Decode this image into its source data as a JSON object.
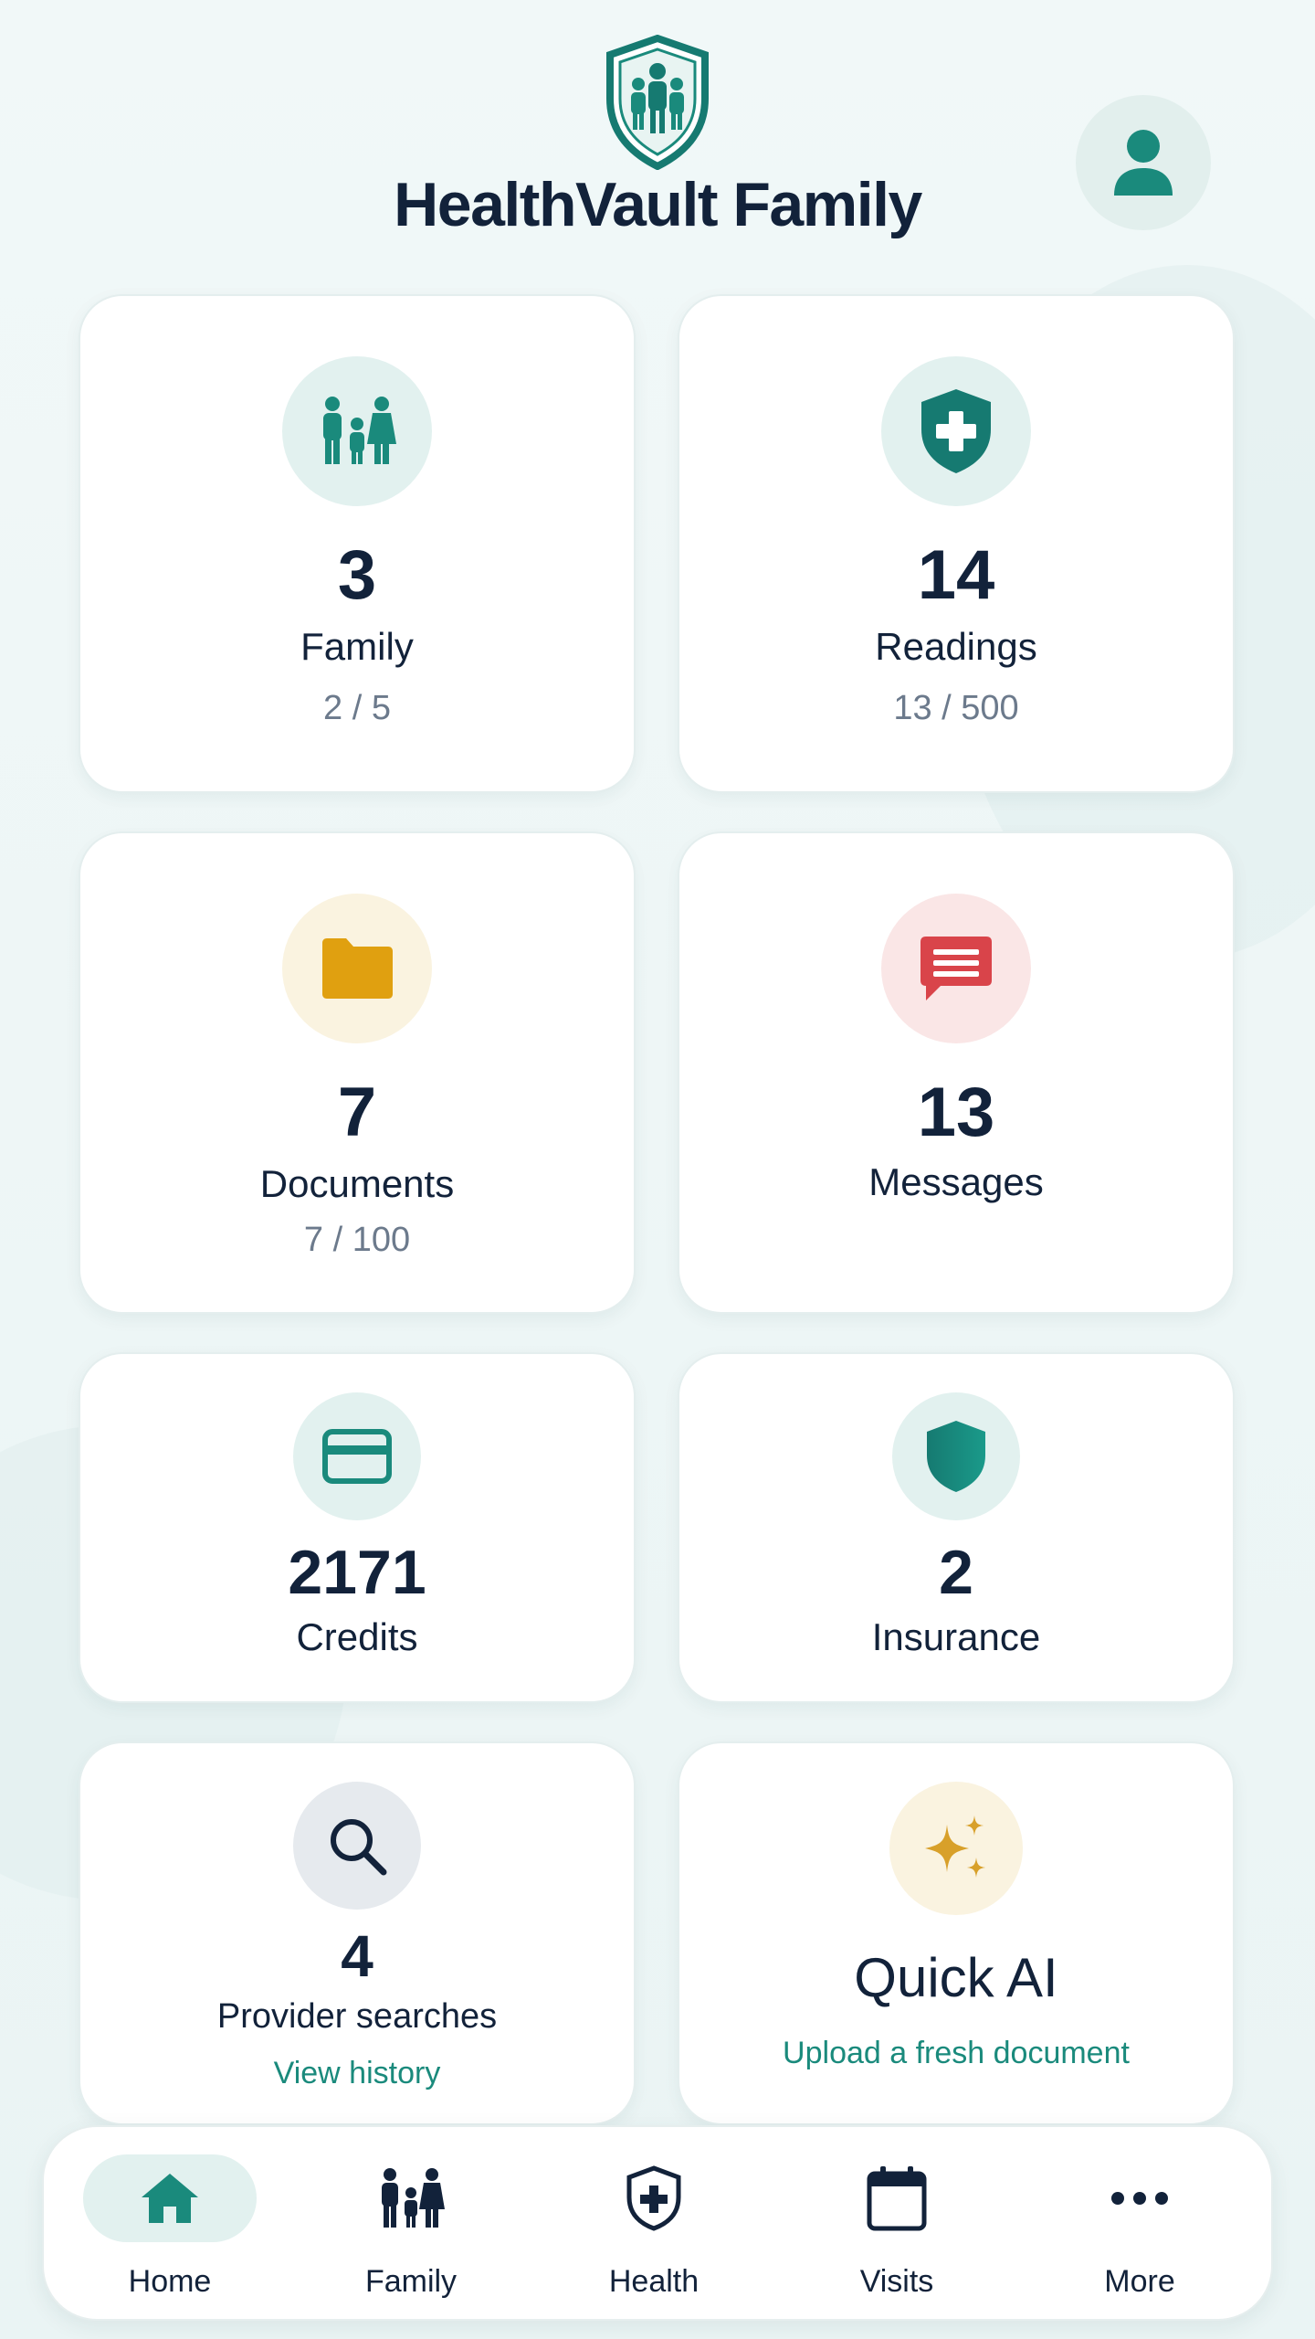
{
  "app": {
    "title": "HealthVault Family"
  },
  "colors": {
    "teal": "#1a8a7c",
    "dark_teal": "#167a71",
    "navy": "#12223a",
    "amber": "#e0a010",
    "red": "#d9444a",
    "gold": "#d8a02a"
  },
  "cards": {
    "family": {
      "count": "3",
      "label": "Family",
      "usage": "2 / 5",
      "icon": "family-icon"
    },
    "readings": {
      "count": "14",
      "label": "Readings",
      "usage": "13 / 500",
      "icon": "shield-plus-icon"
    },
    "documents": {
      "count": "7",
      "label": "Documents",
      "usage": "7 / 100",
      "icon": "folder-icon"
    },
    "messages": {
      "count": "13",
      "label": "Messages",
      "icon": "chat-icon"
    },
    "credits": {
      "count": "2171",
      "label": "Credits",
      "icon": "credit-card-icon"
    },
    "insurance": {
      "count": "2",
      "label": "Insurance",
      "icon": "shield-icon"
    },
    "provider_searches": {
      "count": "4",
      "label": "Provider searches",
      "link": "View history",
      "icon": "search-icon"
    },
    "quick_ai": {
      "title": "Quick AI",
      "link": "Upload a fresh document",
      "icon": "sparkles-icon"
    }
  },
  "nav": {
    "items": [
      {
        "label": "Home",
        "icon": "home-icon",
        "active": true
      },
      {
        "label": "Family",
        "icon": "family-icon",
        "active": false
      },
      {
        "label": "Health",
        "icon": "shield-plus-icon",
        "active": false
      },
      {
        "label": "Visits",
        "icon": "calendar-icon",
        "active": false
      },
      {
        "label": "More",
        "icon": "more-dots-icon",
        "active": false
      }
    ]
  }
}
